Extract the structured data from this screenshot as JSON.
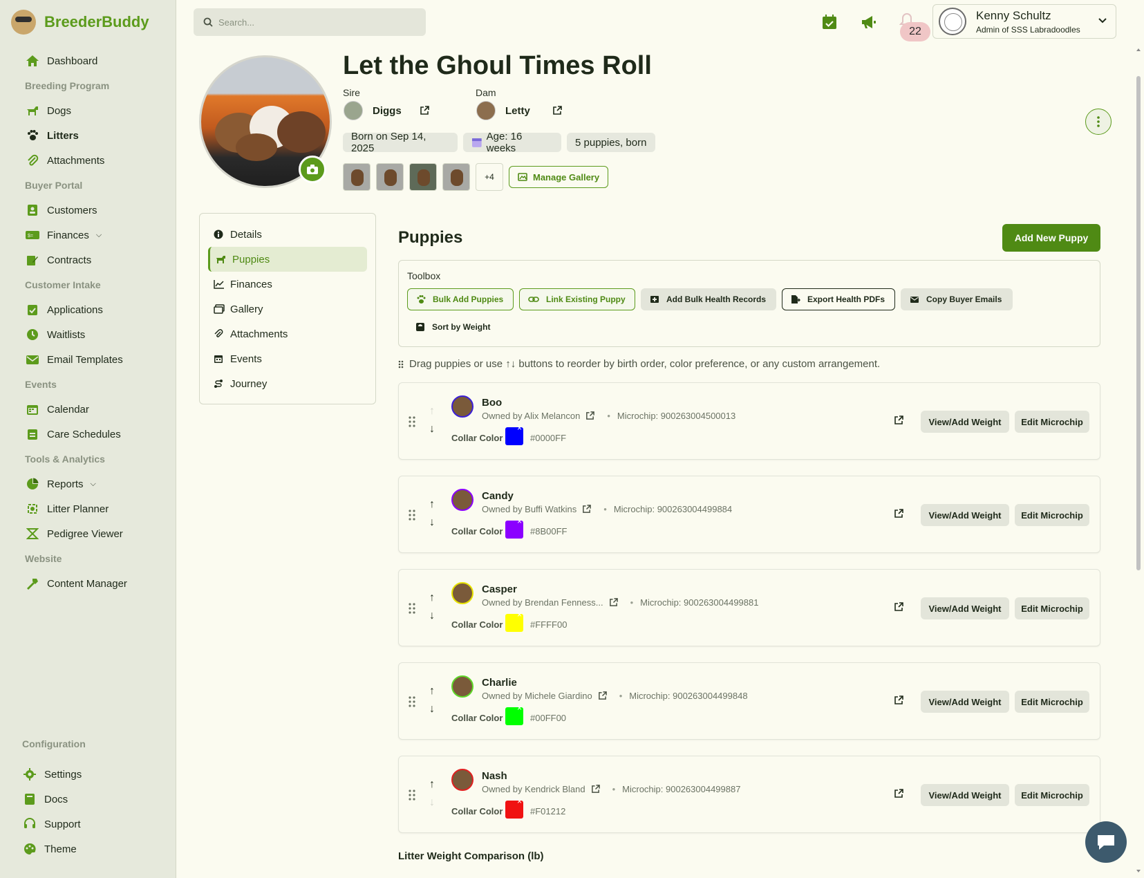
{
  "app": {
    "name": "BreederBuddy"
  },
  "sidebar": {
    "groups": [
      {
        "section": "",
        "items": [
          {
            "label": "Dashboard",
            "icon": "home-icon"
          }
        ]
      },
      {
        "section": "Breeding Program",
        "items": [
          {
            "label": "Dogs",
            "icon": "dog-icon"
          },
          {
            "label": "Litters",
            "icon": "paw-icon",
            "active": true
          },
          {
            "label": "Attachments",
            "icon": "paperclip-icon"
          }
        ]
      },
      {
        "section": "Buyer Portal",
        "items": [
          {
            "label": "Customers",
            "icon": "customers-icon"
          },
          {
            "label": "Finances",
            "icon": "finances-icon",
            "caret": true
          },
          {
            "label": "Contracts",
            "icon": "contract-icon"
          }
        ]
      },
      {
        "section": "Customer Intake",
        "items": [
          {
            "label": "Applications",
            "icon": "clipboard-check-icon"
          },
          {
            "label": "Waitlists",
            "icon": "clock-icon"
          },
          {
            "label": "Email Templates",
            "icon": "email-template-icon"
          }
        ]
      },
      {
        "section": "Events",
        "items": [
          {
            "label": "Calendar",
            "icon": "calendar-icon"
          },
          {
            "label": "Care Schedules",
            "icon": "care-schedule-icon"
          }
        ]
      },
      {
        "section": "Tools & Analytics",
        "items": [
          {
            "label": "Reports",
            "icon": "pie-chart-icon",
            "caret": true
          },
          {
            "label": "Litter Planner",
            "icon": "litter-planner-icon"
          },
          {
            "label": "Pedigree Viewer",
            "icon": "pedigree-icon"
          }
        ]
      },
      {
        "section": "Website",
        "items": [
          {
            "label": "Content Manager",
            "icon": "hammer-icon"
          }
        ]
      }
    ],
    "config_section": "Configuration",
    "config_items": [
      {
        "label": "Settings",
        "icon": "gear-icon"
      },
      {
        "label": "Docs",
        "icon": "book-icon"
      },
      {
        "label": "Support",
        "icon": "headset-icon"
      },
      {
        "label": "Theme",
        "icon": "palette-icon"
      }
    ]
  },
  "topbar": {
    "search_placeholder": "Search...",
    "notification_count": "22",
    "user_name": "Kenny Schultz",
    "user_role": "Admin of SSS Labradoodles"
  },
  "litter": {
    "title": "Let the Ghoul Times Roll",
    "sire_label": "Sire",
    "sire_name": "Diggs",
    "dam_label": "Dam",
    "dam_name": "Letty",
    "born": "Born on Sep 14, 2025",
    "age": "Age: 16 weeks",
    "count": "5 puppies, born",
    "gallery_more": "+4",
    "manage_gallery": "Manage Gallery"
  },
  "tabs": [
    {
      "label": "Details",
      "icon": "info-icon"
    },
    {
      "label": "Puppies",
      "icon": "dog-icon",
      "active": true
    },
    {
      "label": "Finances",
      "icon": "line-chart-icon"
    },
    {
      "label": "Gallery",
      "icon": "images-icon"
    },
    {
      "label": "Attachments",
      "icon": "paperclip-icon"
    },
    {
      "label": "Events",
      "icon": "calendar-icon"
    },
    {
      "label": "Journey",
      "icon": "route-icon"
    }
  ],
  "puppies_section": {
    "title": "Puppies",
    "add_button": "Add New Puppy",
    "toolbox_label": "Toolbox",
    "toolbox": {
      "bulk_add": "Bulk Add Puppies",
      "link_existing": "Link Existing Puppy",
      "bulk_health": "Add Bulk Health Records",
      "export_pdfs": "Export Health PDFs",
      "copy_emails": "Copy Buyer Emails",
      "sort_weight": "Sort by Weight"
    },
    "hint": "Drag puppies or use ↑↓ buttons to reorder by birth order, color preference, or any custom arrangement.",
    "collar_label": "Collar Color",
    "view_weight": "View/Add Weight",
    "edit_microchip": "Edit Microchip",
    "weight_chart_title": "Litter Weight Comparison (lb)"
  },
  "puppies": [
    {
      "name": "Boo",
      "owner": "Owned by Alix Melancon",
      "microchip": "Microchip: 900263004500013",
      "collar_hex": "#0000FF",
      "avatar_border": "#3b1fd6",
      "up_disabled": true,
      "down_disabled": false
    },
    {
      "name": "Candy",
      "owner": "Owned by Buffi Watkins",
      "microchip": "Microchip: 900263004499884",
      "collar_hex": "#8B00FF",
      "avatar_border": "#8b00ff",
      "up_disabled": false,
      "down_disabled": false
    },
    {
      "name": "Casper",
      "owner": "Owned by Brendan Fenness...",
      "microchip": "Microchip: 900263004499881",
      "collar_hex": "#FFFF00",
      "avatar_border": "#e7e200",
      "up_disabled": false,
      "down_disabled": false
    },
    {
      "name": "Charlie",
      "owner": "Owned by Michele Giardino",
      "microchip": "Microchip: 900263004499848",
      "collar_hex": "#00FF00",
      "avatar_border": "#5fd82a",
      "up_disabled": false,
      "down_disabled": false
    },
    {
      "name": "Nash",
      "owner": "Owned by Kendrick Bland",
      "microchip": "Microchip: 900263004499887",
      "collar_hex": "#F01212",
      "avatar_border": "#e02020",
      "up_disabled": false,
      "down_disabled": true
    }
  ],
  "colors": {
    "brand": "#5c9b1c",
    "brand_dark": "#4f8a14",
    "sidebar_bg": "#e6e9dc",
    "page_bg": "#fbfbf0"
  }
}
